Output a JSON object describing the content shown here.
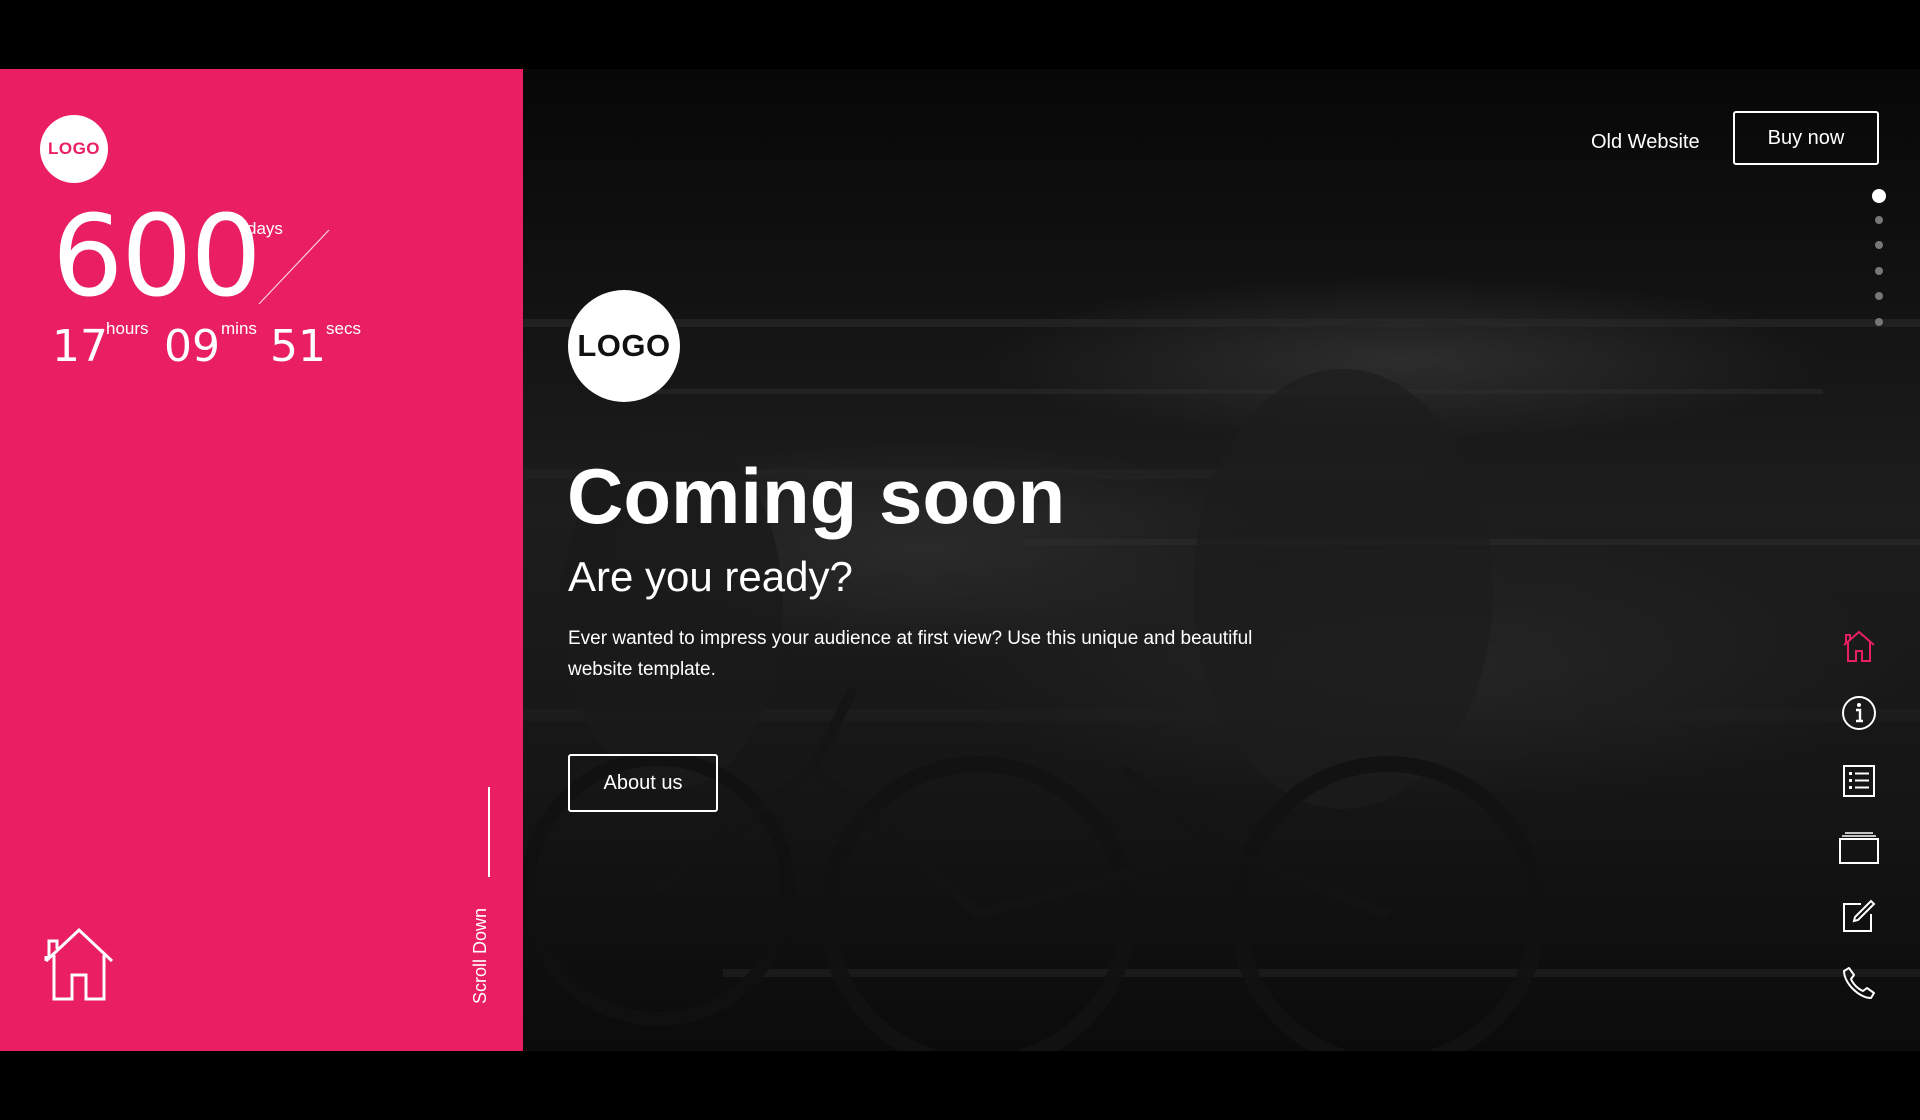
{
  "countdown": {
    "days": "600",
    "days_label": "days",
    "hours": "17",
    "hours_label": "hours",
    "mins": "09",
    "mins_label": "mins",
    "secs": "51",
    "secs_label": "secs"
  },
  "left_panel": {
    "logo_text": "LOGO",
    "scroll_label": "Scroll Down",
    "home_icon": "home-icon"
  },
  "header": {
    "old_website_label": "Old Website",
    "buy_label": "Buy now"
  },
  "hero": {
    "logo_text": "LOGO",
    "title": "Coming soon",
    "subtitle": "Are you ready?",
    "description": "Ever wanted to impress your audience at first view? Use this unique and beautiful website template.",
    "cta_label": "About us"
  },
  "page_dots": [
    {
      "active": true
    },
    {
      "active": false
    },
    {
      "active": false
    },
    {
      "active": false
    },
    {
      "active": false
    },
    {
      "active": false
    }
  ],
  "side_nav": [
    {
      "icon": "home-icon",
      "active": true
    },
    {
      "icon": "info-icon",
      "active": false
    },
    {
      "icon": "list-icon",
      "active": false
    },
    {
      "icon": "gallery-icon",
      "active": false
    },
    {
      "icon": "edit-icon",
      "active": false
    },
    {
      "icon": "phone-icon",
      "active": false
    }
  ],
  "colors": {
    "accent": "#e91e63",
    "background": "#000000",
    "text": "#ffffff"
  }
}
